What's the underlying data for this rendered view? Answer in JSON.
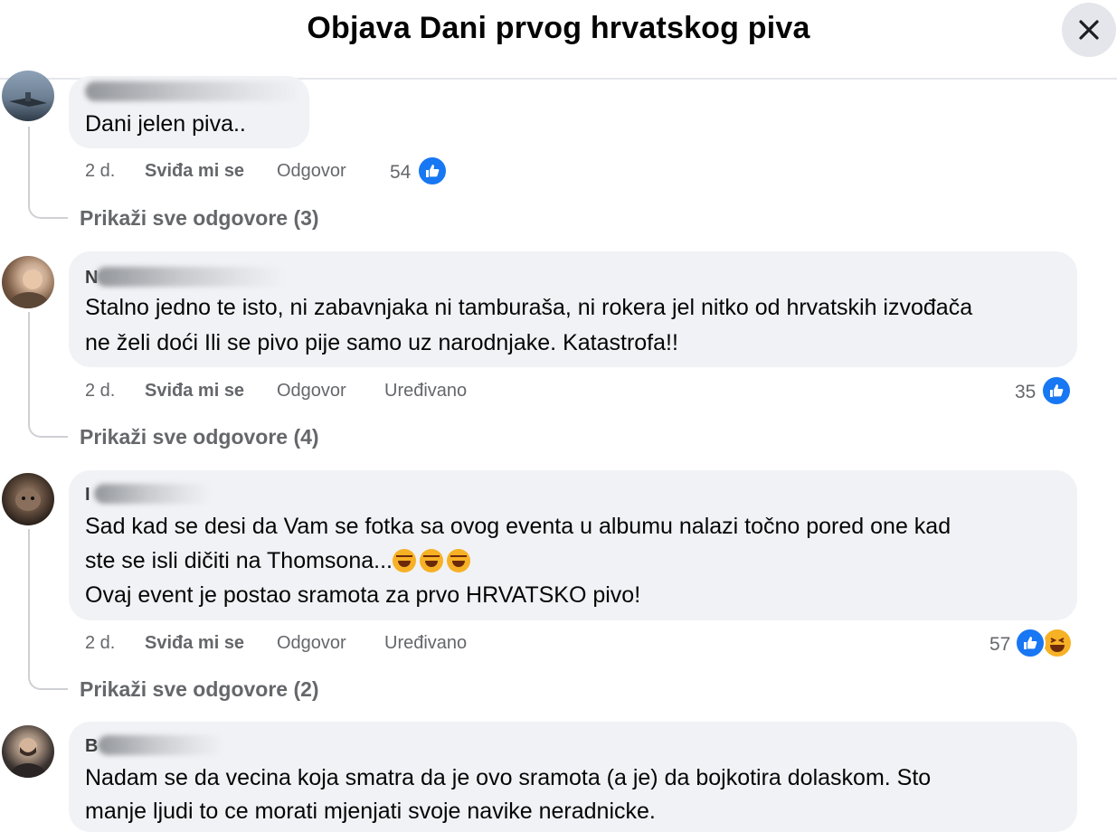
{
  "header": {
    "title": "Objava Dani prvog hrvatskog piva"
  },
  "comments": [
    {
      "text_lines": [
        "Dani jelen piva.."
      ],
      "time": "2 d.",
      "like_label": "Sviđa mi se",
      "reply_label": "Odgovor",
      "edited_label": "",
      "reaction_count": "54",
      "reactions": [
        "like-icon"
      ],
      "replies_label": "Prikaži sve odgovore (3)"
    },
    {
      "name_initial": "N",
      "text_lines": [
        "Stalno jedno te isto, ni zabavnjaka ni tamburaša, ni rokera jel nitko od hrvatskih izvođača",
        "ne želi doći Ili se pivo pije samo uz narodnjake. Katastrofa!!"
      ],
      "time": "2 d.",
      "like_label": "Sviđa mi se",
      "reply_label": "Odgovor",
      "edited_label": "Uređivano",
      "reaction_count": "35",
      "reactions": [
        "like-icon"
      ],
      "replies_label": "Prikaži sve odgovore (4)"
    },
    {
      "name_initial": "I",
      "text_lines": [
        "Sad kad se desi da Vam se fotka sa ovog eventa u albumu nalazi točno pored one kad",
        "ste se isli dičiti na Thomsona...",
        "Ovaj event je postao sramota za prvo HRVATSKO pivo!"
      ],
      "emojis": [
        "rolling-on-floor-laughing-emoji",
        "rolling-on-floor-laughing-emoji",
        "rolling-on-floor-laughing-emoji"
      ],
      "time": "2 d.",
      "like_label": "Sviđa mi se",
      "reply_label": "Odgovor",
      "edited_label": "Uređivano",
      "reaction_count": "57",
      "reactions": [
        "like-icon",
        "haha-icon"
      ],
      "replies_label": "Prikaži sve odgovore (2)"
    },
    {
      "name_initial": "B",
      "text_lines": [
        "Nadam se da vecina koja smatra da je ovo sramota (a je) da bojkotira dolaskom. Sto",
        "manje ljudi to ce morati mjenjati svoje navike neradnicke."
      ]
    }
  ],
  "colors": {
    "bubble": "#f0f2f5",
    "meta_text": "#65676b",
    "like_blue": "#1877f2",
    "haha_yellow": "#f7b125",
    "thread_line": "#ced0d4"
  }
}
